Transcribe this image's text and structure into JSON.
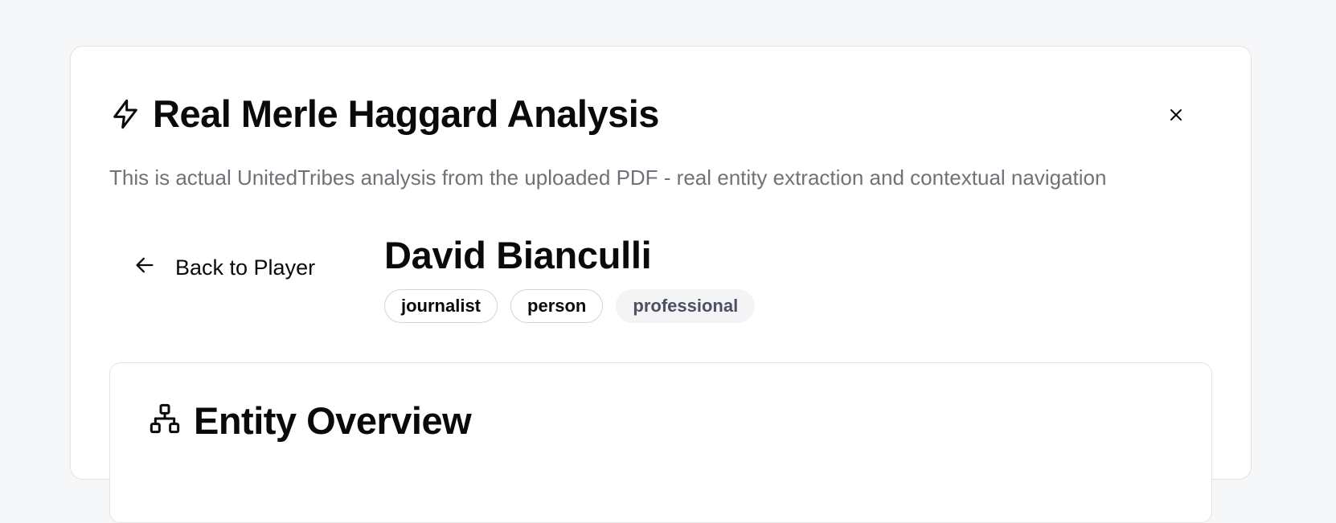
{
  "dialog": {
    "title": "Real Merle Haggard Analysis",
    "title_icon": "lightning-icon",
    "close_label": "×",
    "subtitle": "This is actual UnitedTribes analysis from the uploaded PDF - real entity extraction and contextual navigation"
  },
  "navigation": {
    "back_label": "Back to Player",
    "back_icon": "arrow-left-icon"
  },
  "entity": {
    "name": "David Bianculli",
    "tags": [
      "journalist",
      "person",
      "professional"
    ]
  },
  "overview": {
    "title": "Entity Overview",
    "icon": "hierarchy-icon"
  },
  "colors": {
    "background": "#f6f7f9",
    "text": "#0a0a0a",
    "muted": "#71717a",
    "border": "#e4e4e7",
    "soft_tag_bg": "#f4f4f6",
    "soft_tag_text": "#4b5160"
  }
}
